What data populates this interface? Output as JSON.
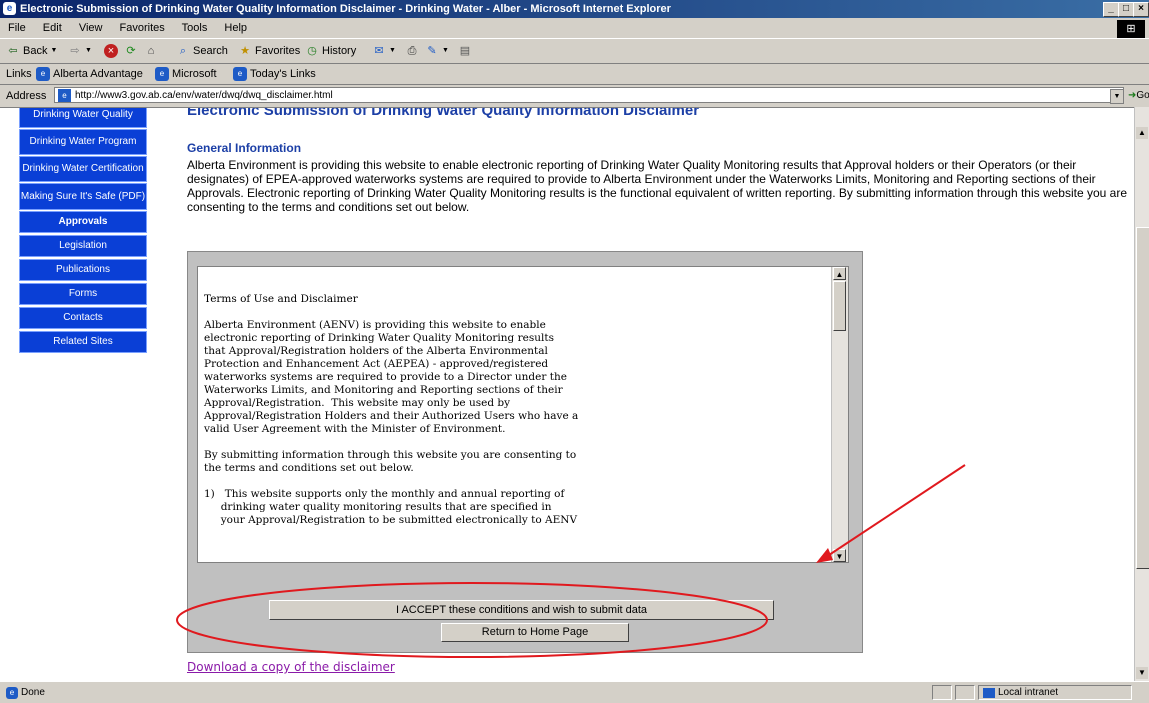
{
  "window": {
    "title": "Electronic Submission of Drinking Water Quality Information Disclaimer - Drinking Water - Alber - Microsoft Internet Explorer",
    "min_label": "_",
    "max_label": "□",
    "close_label": "×"
  },
  "menu": [
    "File",
    "Edit",
    "View",
    "Favorites",
    "Tools",
    "Help"
  ],
  "toolbar": {
    "back": "Back",
    "search": "Search",
    "favorites": "Favorites",
    "history": "History"
  },
  "links_bar": {
    "label": "Links",
    "items": [
      "Alberta Advantage",
      "Microsoft",
      "Today's Links"
    ]
  },
  "address": {
    "label": "Address",
    "url": "http://www3.gov.ab.ca/env/water/dwq/dwq_disclaimer.html",
    "go": "Go"
  },
  "sidebar": {
    "items": [
      {
        "label": "Drinking Water Quality"
      },
      {
        "label": "Drinking Water Program"
      },
      {
        "label": "Drinking Water Certification"
      },
      {
        "label": "Making Sure It's Safe (PDF)"
      },
      {
        "label": "Approvals"
      },
      {
        "label": "Legislation"
      },
      {
        "label": "Publications"
      },
      {
        "label": "Forms"
      },
      {
        "label": "Contacts"
      },
      {
        "label": "Related Sites"
      }
    ]
  },
  "main": {
    "heading": "Electronic Submission of Drinking Water Quality Information Disclaimer",
    "section_title": "General Information",
    "intro": "Alberta Environment is providing this website to enable electronic reporting of Drinking Water Quality Monitoring results that Approval holders or their Operators (or their designates) of EPEA-approved waterworks systems are required to provide to Alberta Environment under the Waterworks Limits, Monitoring and Reporting sections of their Approvals. Electronic reporting of Drinking Water Quality Monitoring results is the functional equivalent of written reporting. By submitting information through this website you are consenting to the terms and conditions set out below.",
    "terms": {
      "title": "Terms of Use and Disclaimer",
      "para1": "Alberta Environment (AENV) is providing this website to enable\nelectronic reporting of Drinking Water Quality Monitoring results\nthat Approval/Registration holders of the Alberta Environmental\nProtection and Enhancement Act (AEPEA) - approved/registered\nwaterworks systems are required to provide to a Director under the\nWaterworks Limits, and Monitoring and Reporting sections of their\nApproval/Registration.  This website may only be used by\nApproval/Registration Holders and their Authorized Users who have a\nvalid User Agreement with the Minister of Environment.",
      "para2": "By submitting information through this website you are consenting to\nthe terms and conditions set out below.",
      "para3": "1)   This website supports only the monthly and annual reporting of\n     drinking water quality monitoring results that are specified in\n     your Approval/Registration to be submitted electronically to AENV"
    },
    "accept_button": "I ACCEPT these conditions and wish to submit data",
    "home_button": "Return to Home Page",
    "download_link": "Download a copy of the disclaimer"
  },
  "status": {
    "left": "Done",
    "zone": "Local intranet"
  },
  "colors": {
    "nav": "#0a3fd6",
    "heading": "#1c3fa6",
    "annotation": "#e0191e"
  }
}
